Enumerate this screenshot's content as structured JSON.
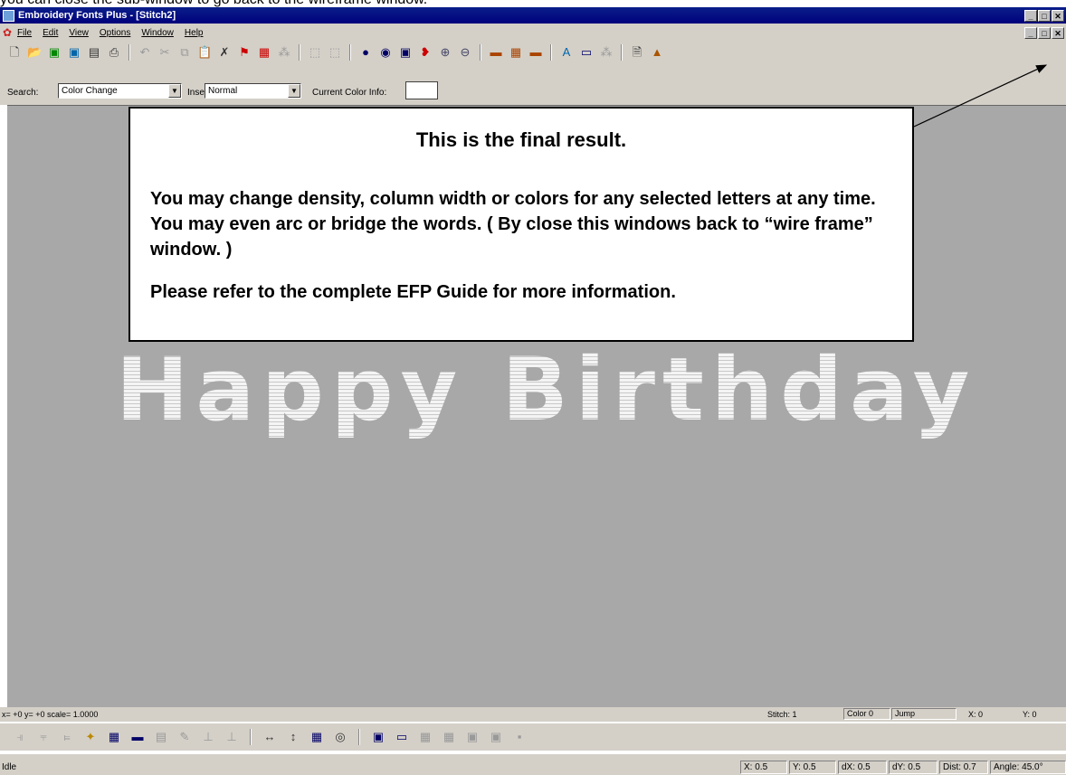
{
  "caption": "you can close the sub-window to go back to the wireframe window.",
  "window": {
    "title": "Embroidery Fonts Plus - [Stitch2]",
    "controls": [
      "_",
      "□",
      "✕"
    ],
    "doc_controls": [
      "_",
      "□",
      "✕"
    ]
  },
  "menu": [
    "File",
    "Edit",
    "View",
    "Options",
    "Window",
    "Help"
  ],
  "toolbar": {
    "icons": [
      "new-icon",
      "open-icon",
      "open-green-icon",
      "open-blue-icon",
      "save-icon",
      "print-icon",
      "undo-icon",
      "cut-icon",
      "copy-icon",
      "paste-icon",
      "delete-icon",
      "stitch-red-icon",
      "stitch-grid-icon",
      "pattern-icon",
      "select-icon",
      "select2-icon",
      "point-icon",
      "view-eye-icon",
      "view-frame-icon",
      "view-red-icon",
      "zoom-in-icon",
      "zoom-out-icon",
      "color-load-icon",
      "color-set-icon",
      "color-save-icon",
      "font-icon",
      "frame-icon",
      "pattern2-icon",
      "doc-icon",
      "image-icon"
    ]
  },
  "search": {
    "search_label": "Search:",
    "search_value": "Color Change",
    "insert_label": "Insert:",
    "insert_value": "Normal",
    "color_label": "Current Color Info:"
  },
  "callout": {
    "title": "This is the final result.",
    "body": "You may change density, column width or colors for any selected letters at any time. You may even arc or bridge the words. ( By close this windows back to “wire frame” window. )",
    "note": "Please refer to the complete EFP Guide for more information."
  },
  "design_text": "Happy Birthday",
  "status_top": {
    "coords": "x= +0 y= +0 scale= 1.0000",
    "stitch": "Stitch: 1",
    "color": "Color 0",
    "type": "Jump",
    "x": "X: 0",
    "y": "Y: 0"
  },
  "status_bottom": {
    "state": "Idle",
    "X": "X: 0.5",
    "Y": "Y: 0.5",
    "dX": "dX: 0.5",
    "dY": "dY: 0.5",
    "dist": "Dist: 0.7",
    "angle": "Angle: 45.0°"
  },
  "colors": {
    "titlebar": "#00007b",
    "canvas": "#a8a8a8",
    "chrome": "#d4d0c8"
  }
}
